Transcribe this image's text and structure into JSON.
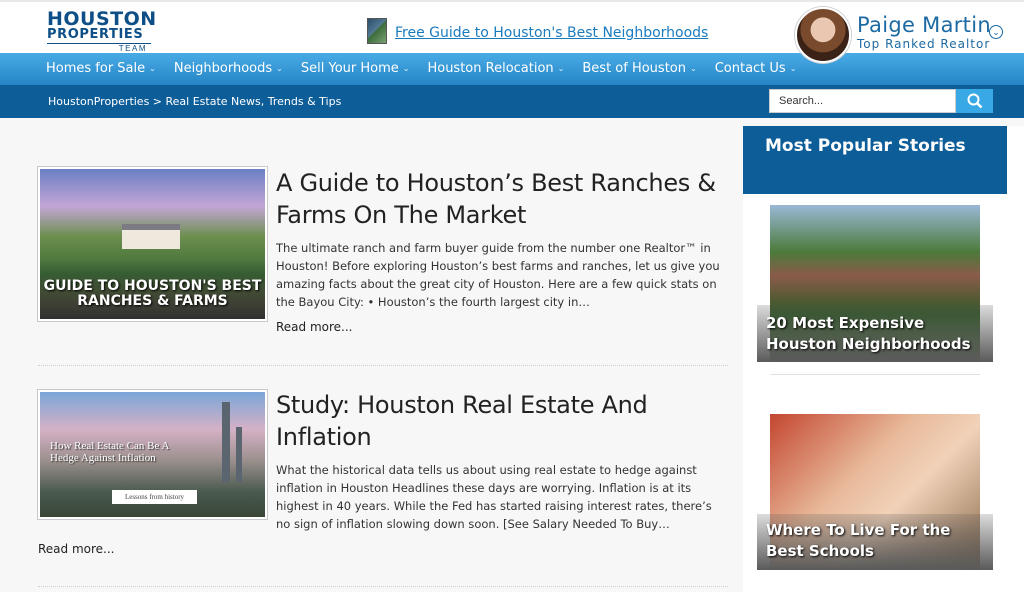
{
  "header": {
    "logo": {
      "line1": "HOUSTON",
      "line2": "PROPERTIES",
      "line3": "TEAM"
    },
    "guide_link": "Free Guide to Houston's Best Neighborhoods",
    "agent": {
      "name": "Paige Martin",
      "title": "Top Ranked Realtor"
    }
  },
  "nav": {
    "items": [
      {
        "label": "Homes for Sale"
      },
      {
        "label": "Neighborhoods"
      },
      {
        "label": "Sell Your Home"
      },
      {
        "label": "Houston Relocation"
      },
      {
        "label": "Best of Houston"
      },
      {
        "label": "Contact Us"
      }
    ]
  },
  "breadcrumb": "HoustonProperties > Real Estate News, Trends & Tips",
  "search": {
    "placeholder": "Search..."
  },
  "articles": [
    {
      "title": "A Guide to Houston’s Best Ranches & Farms On The Market",
      "image_text": "GUIDE TO HOUSTON'S BEST RANCHES & FARMS",
      "excerpt": "The ultimate ranch and farm buyer guide from the number one Realtor™ in Houston! Before exploring Houston’s best farms and ranches, let us give you amazing facts about the great city of Houston. Here are a few quick stats on the Bayou City: • Houston’s the fourth largest city in…",
      "read_more": "Read more..."
    },
    {
      "title": "Study: Houston Real Estate And Inflation",
      "image_text": "How Real Estate Can Be A Hedge Against Inflation",
      "image_tag": "Lessons from history",
      "excerpt": "What the historical data tells us about using real estate to hedge against inflation in Houston Headlines these days are worrying. Inflation is at its highest in 40 years. While the Fed has started raising interest rates, there’s no sign of inflation slowing down soon. [See Salary Needed To Buy…",
      "read_more": "Read more..."
    }
  ],
  "sidebar": {
    "heading": "Most Popular Stories",
    "stories": [
      {
        "caption": "20 Most Expensive Houston Neighborhoods"
      },
      {
        "caption": "Where To Live For the Best Schools"
      }
    ]
  },
  "colors": {
    "nav_blue": "#2f95d6",
    "dark_blue": "#0d5d99",
    "link_blue": "#1a7bbf"
  },
  "icons": [
    "book-icon",
    "chevron-down-icon",
    "search-icon"
  ]
}
